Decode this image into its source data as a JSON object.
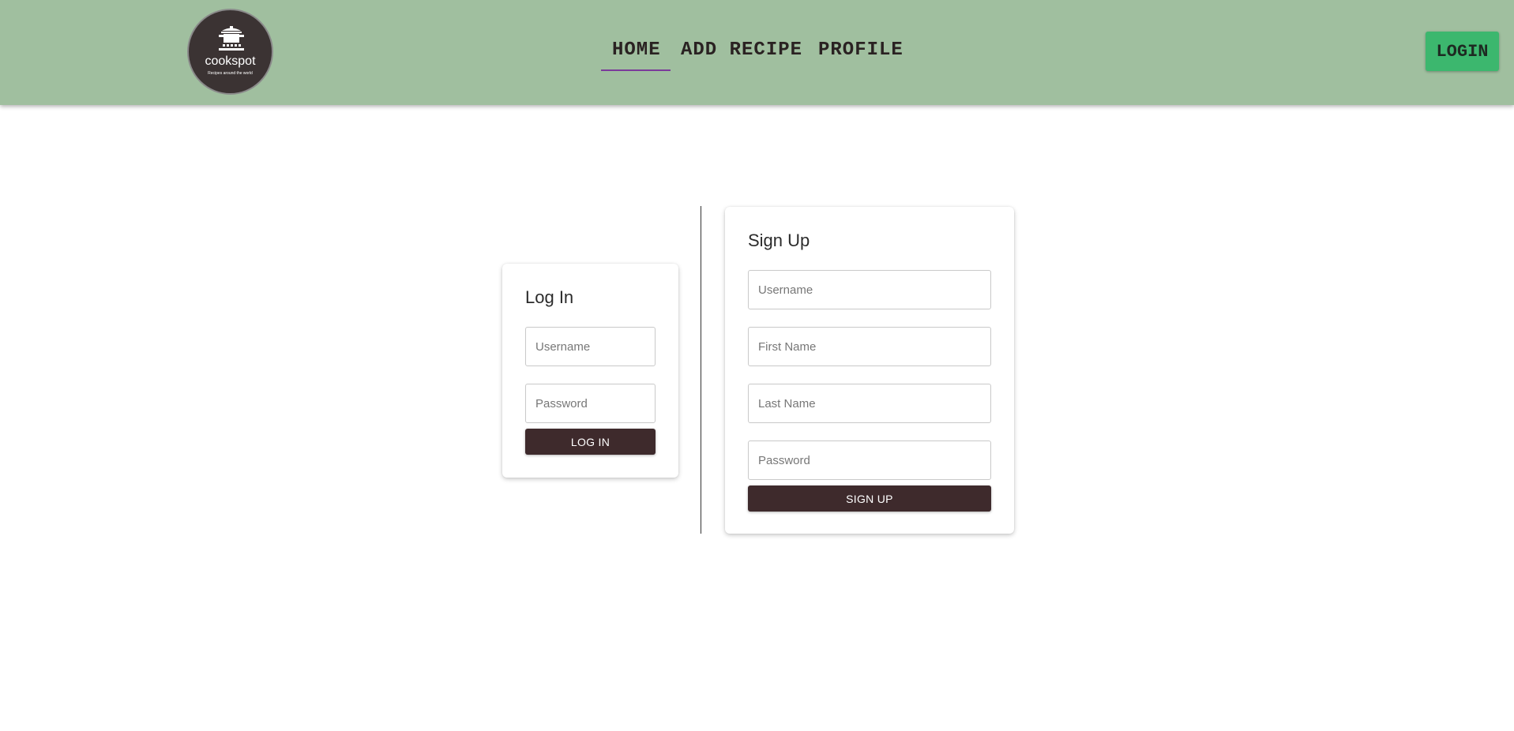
{
  "header": {
    "logo": {
      "name": "cookspot",
      "tagline": "Recipes around the world"
    },
    "nav": [
      {
        "label": "HOME",
        "active": true
      },
      {
        "label": "ADD RECIPE",
        "active": false
      },
      {
        "label": "PROFILE",
        "active": false
      }
    ],
    "login_label": "LOGIN"
  },
  "login_form": {
    "title": "Log In",
    "username_placeholder": "Username",
    "password_placeholder": "Password",
    "submit_label": "LOG IN"
  },
  "signup_form": {
    "title": "Sign Up",
    "username_placeholder": "Username",
    "first_name_placeholder": "First Name",
    "last_name_placeholder": "Last Name",
    "password_placeholder": "Password",
    "submit_label": "SIGN UP"
  },
  "colors": {
    "header_bg": "#a0bf9f",
    "login_button": "#3cb76e",
    "dark_button": "#3e2a2c",
    "active_underline": "#7b3a9a",
    "logo_bg": "#3b3333"
  },
  "icons": {
    "logo": "cooking-pot-icon"
  }
}
